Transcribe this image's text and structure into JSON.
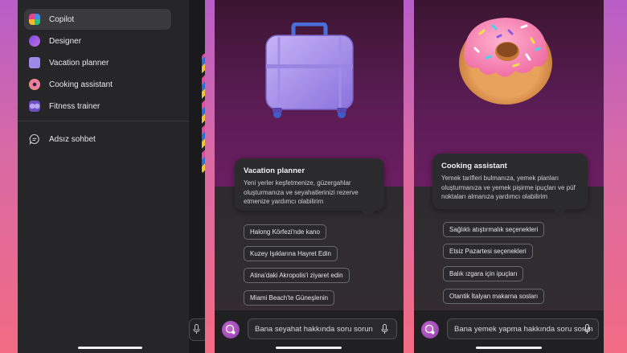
{
  "panel1": {
    "menu": [
      {
        "label": "Copilot",
        "icon": "copilot-icon",
        "active": true
      },
      {
        "label": "Designer",
        "icon": "designer-icon",
        "active": false
      },
      {
        "label": "Vacation planner",
        "icon": "suitcase-icon",
        "active": false
      },
      {
        "label": "Cooking assistant",
        "icon": "donut-icon",
        "active": false
      },
      {
        "label": "Fitness trainer",
        "icon": "fitness-icon",
        "active": false
      }
    ],
    "new_chat": {
      "label": "Adsız sohbet",
      "icon": "chat-bubble-icon"
    }
  },
  "panel2": {
    "illustration": "suitcase-illustration",
    "card": {
      "title": "Vacation planner",
      "description": "Yeni yerler keşfetmenize, güzergahlar oluşturmanıza ve seyahatlerinizi rezerve etmenize yardımcı olabilirim"
    },
    "suggestions": [
      "Halong Körfezi'nde kano",
      "Kuzey Işıklarına Hayret Edin",
      "Atina'daki Akropolis'i ziyaret edin",
      "Miami Beach'te Güneşlenin"
    ],
    "input_placeholder": "Bana seyahat hakkında soru sorun"
  },
  "panel3": {
    "illustration": "donut-illustration",
    "card": {
      "title": "Cooking assistant",
      "description": "Yemek tarifleri bulmanıza, yemek planları oluşturmanıza ve yemek pişirme ipuçları ve püf noktaları almanıza yardımcı olabilirim"
    },
    "suggestions": [
      "Sağlıklı atıştırmalık seçenekleri",
      "Etsiz Pazartesi seçenekleri",
      "Balık ızgara için ipuçları",
      "Otantik İtalyan makarna sosları"
    ],
    "input_placeholder": "Bana yemek yapma hakkında soru sorun"
  },
  "colors": {
    "background_top": "#b85ec8",
    "background_bottom": "#f26b83",
    "panel_dark": "#1c1c1e",
    "stage_purple": "#5a1c54",
    "card_bg": "#2b2b2e"
  }
}
